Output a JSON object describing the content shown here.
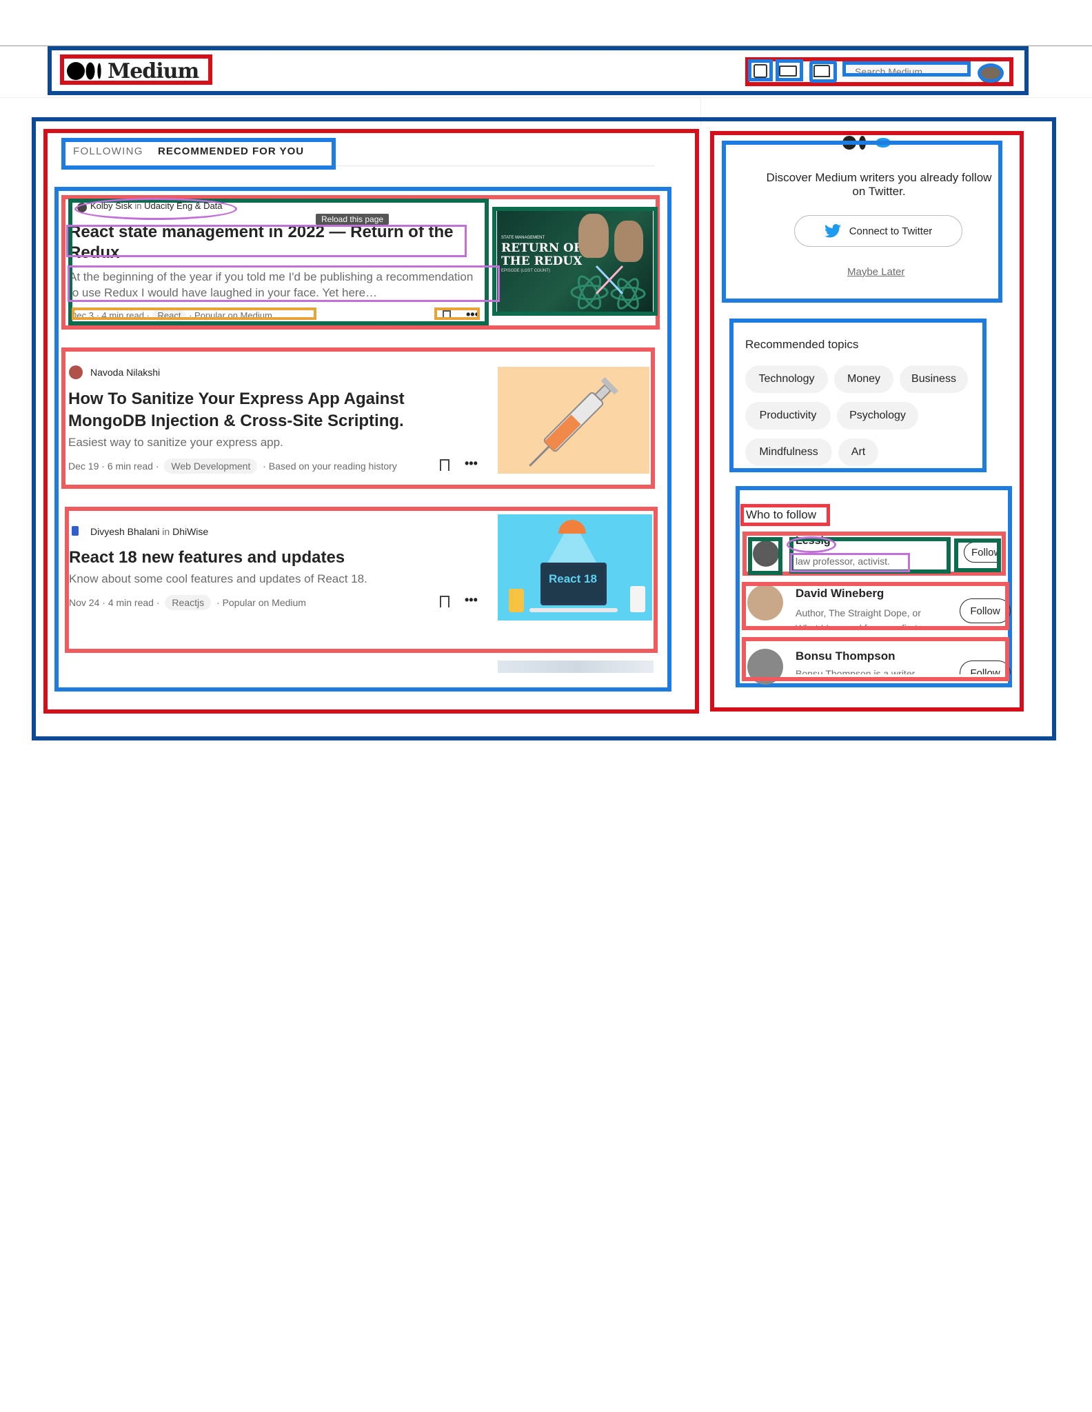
{
  "header": {
    "logo_text": "Medium",
    "search_placeholder": "Search Medium",
    "icons": [
      "write-icon",
      "list-icon",
      "notifications-icon"
    ]
  },
  "feed": {
    "tabs": [
      {
        "label": "FOLLOWING"
      },
      {
        "label": "RECOMMENDED FOR YOU"
      }
    ],
    "tooltip": "Reload this page",
    "articles": [
      {
        "author": "Kolby Sisk",
        "in_word": "in",
        "publication": "Udacity Eng & Data",
        "title": "React state management in 2022 — Return of the Redux",
        "subtitle": "At the beginning of the year if you told me I'd be publishing a recommendation to use Redux I would have laughed in your face. Yet here…",
        "date": "Dec 3",
        "read_time": "4 min read",
        "tag": "React",
        "reason": "Popular on Medium",
        "thumb_text_1": "STATE MANAGEMENT",
        "thumb_text_2": "RETURN OF",
        "thumb_text_3": "THE REDUX",
        "thumb_text_4": "EPISODE (LOST COUNT)"
      },
      {
        "author": "Navoda Nilakshi",
        "title": "How To Sanitize Your Express App Against MongoDB Injection & Cross-Site Scripting.",
        "subtitle": "Easiest way to sanitize your express app.",
        "date": "Dec 19",
        "read_time": "6 min read",
        "tag": "Web Development",
        "reason": "Based on your reading history"
      },
      {
        "author": "Divyesh Bhalani",
        "in_word": "in",
        "publication": "DhiWise",
        "title": "React 18 new features and updates",
        "subtitle": "Know about some cool features and updates of React 18.",
        "date": "Nov 24",
        "read_time": "4 min read",
        "tag": "Reactjs",
        "reason": "Popular on Medium",
        "thumb_label": "React 18"
      }
    ]
  },
  "sidebar": {
    "twitter": {
      "text": "Discover Medium writers you already follow on Twitter.",
      "button": "Connect to Twitter",
      "later": "Maybe Later"
    },
    "topics": {
      "heading": "Recommended topics",
      "items": [
        "Technology",
        "Money",
        "Business",
        "Productivity",
        "Psychology",
        "Mindfulness",
        "Art"
      ]
    },
    "who_to_follow": {
      "heading": "Who to follow",
      "people": [
        {
          "name": "Lessig",
          "bio": "law professor, activist.",
          "button": "Follow"
        },
        {
          "name": "David Wineberg",
          "bio": "Author, The Straight Dope, or What I Learned from my first…",
          "button": "Follow"
        },
        {
          "name": "Bonsu Thompson",
          "bio": "Bonsu Thompson is a writer…",
          "button": "Follow"
        }
      ]
    }
  },
  "colors": {
    "annotation_navy": "#0d4a96",
    "annotation_red": "#d40f1a",
    "annotation_blue": "#1e7be0",
    "annotation_salmon": "#ef5a5f",
    "annotation_green": "#0b6b4c",
    "annotation_purple": "#c070d6",
    "annotation_orange": "#e7a337",
    "twitter_blue": "#1d9bf0"
  }
}
